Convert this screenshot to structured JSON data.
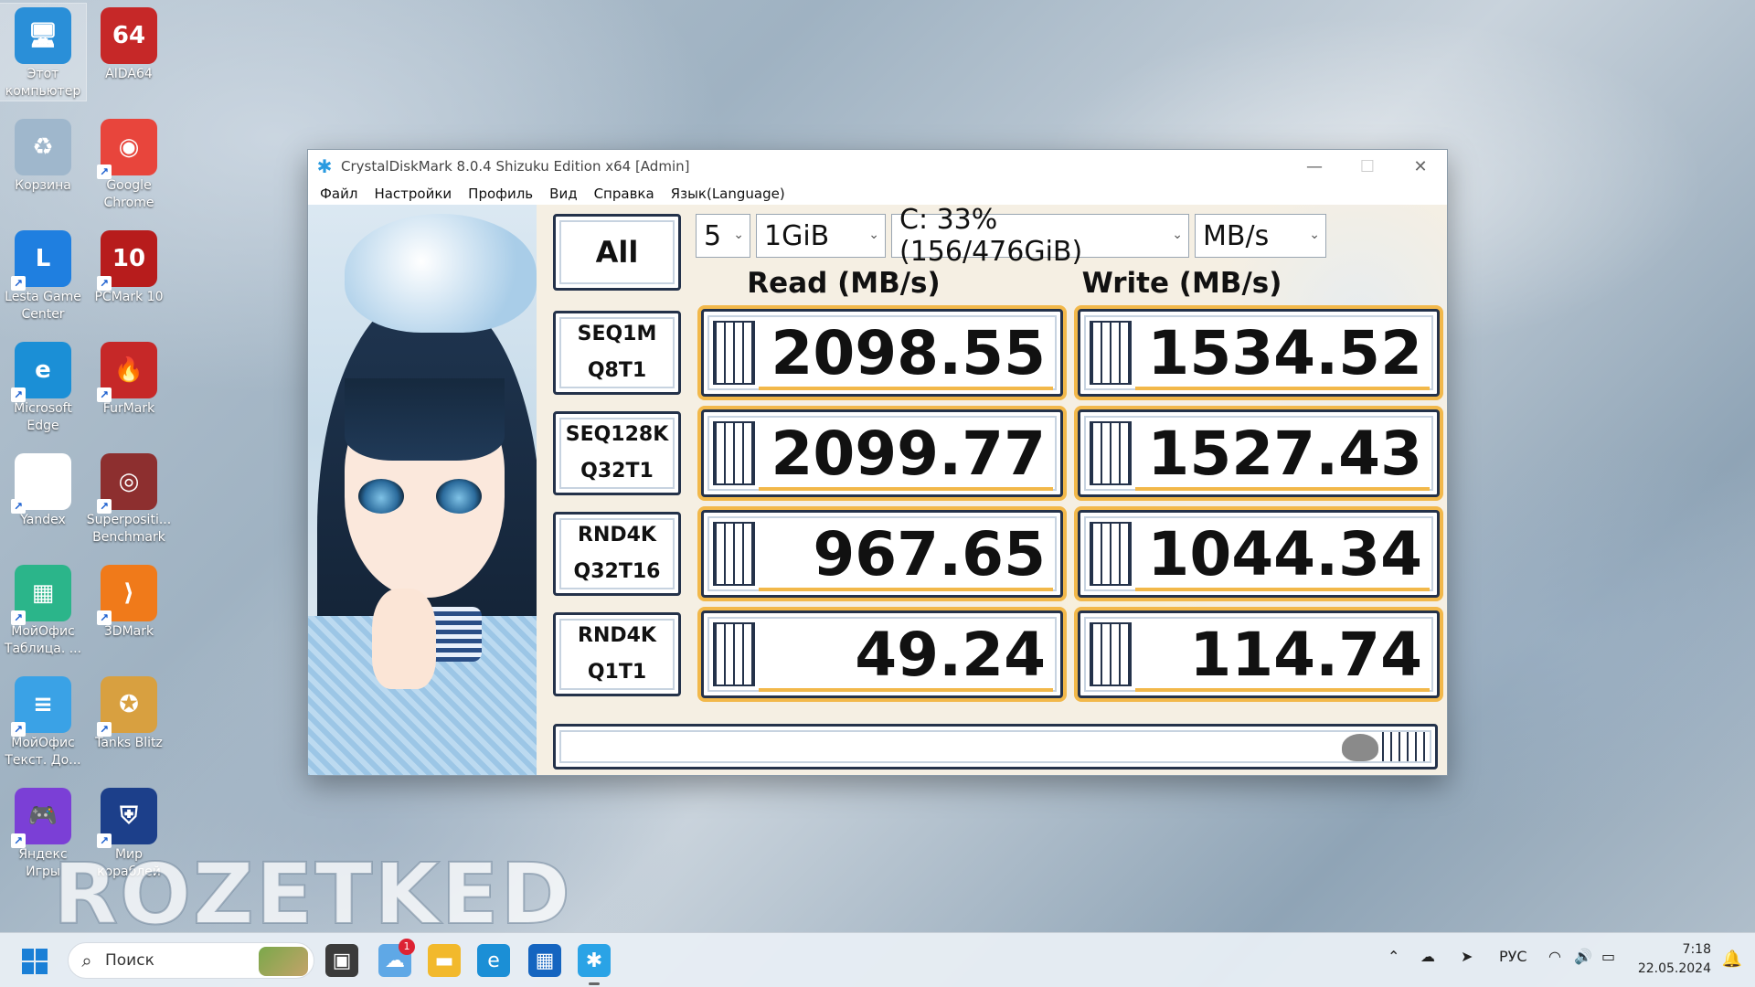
{
  "desktop": {
    "icons": [
      {
        "label": "Этот компьютер",
        "glyph": "🖥",
        "color": "#2a8fd8"
      },
      {
        "label": "AIDA64",
        "glyph": "64",
        "color": "#c62828"
      },
      {
        "label": "Корзина",
        "glyph": "♻",
        "color": "#9fb7cc"
      },
      {
        "label": "Google Chrome",
        "glyph": "◉",
        "color": "#e8453c"
      },
      {
        "label": "Lesta Game Center",
        "glyph": "L",
        "color": "#1f7fe0"
      },
      {
        "label": "PCMark 10",
        "glyph": "10",
        "color": "#b71c1c"
      },
      {
        "label": "Microsoft Edge",
        "glyph": "e",
        "color": "#1b8fd6"
      },
      {
        "label": "FurMark",
        "glyph": "🔥",
        "color": "#c62828"
      },
      {
        "label": "Yandex",
        "glyph": "Y",
        "color": "#ffffff"
      },
      {
        "label": "Superpositi... Benchmark",
        "glyph": "◎",
        "color": "#8d2f2f"
      },
      {
        "label": "МойОфис Таблица. ...",
        "glyph": "▦",
        "color": "#2bb58a"
      },
      {
        "label": "3DMark",
        "glyph": "⟩",
        "color": "#f07a1a"
      },
      {
        "label": "МойОфис Текст. До...",
        "glyph": "≡",
        "color": "#3aa2e6"
      },
      {
        "label": "Tanks Blitz",
        "glyph": "✪",
        "color": "#d8a040"
      },
      {
        "label": "Яндекс Игры",
        "glyph": "🎮",
        "color": "#7b3fd6"
      },
      {
        "label": "Мир кораблей",
        "glyph": "⛨",
        "color": "#1c3f8a"
      }
    ],
    "watermark": "ROZETKED"
  },
  "window": {
    "title": "CrystalDiskMark 8.0.4 Shizuku Edition x64 [Admin]",
    "menu": [
      "Файл",
      "Настройки",
      "Профиль",
      "Вид",
      "Справка",
      "Язык(Language)"
    ],
    "all_label": "All",
    "count": "5",
    "size": "1GiB",
    "drive": "C: 33% (156/476GiB)",
    "unit": "MB/s",
    "read_header": "Read (MB/s)",
    "write_header": "Write (MB/s)",
    "rows": [
      {
        "line1": "SEQ1M",
        "line2": "Q8T1",
        "read": "2098.55",
        "write": "1534.52"
      },
      {
        "line1": "SEQ128K",
        "line2": "Q32T1",
        "read": "2099.77",
        "write": "1527.43"
      },
      {
        "line1": "RND4K",
        "line2": "Q32T16",
        "read": "967.65",
        "write": "1044.34"
      },
      {
        "line1": "RND4K",
        "line2": "Q1T1",
        "read": "49.24",
        "write": "114.74"
      }
    ]
  },
  "taskbar": {
    "search_placeholder": "Поиск",
    "weather_badge": "1",
    "lang": "РУС",
    "time": "7:18",
    "date": "22.05.2024"
  }
}
